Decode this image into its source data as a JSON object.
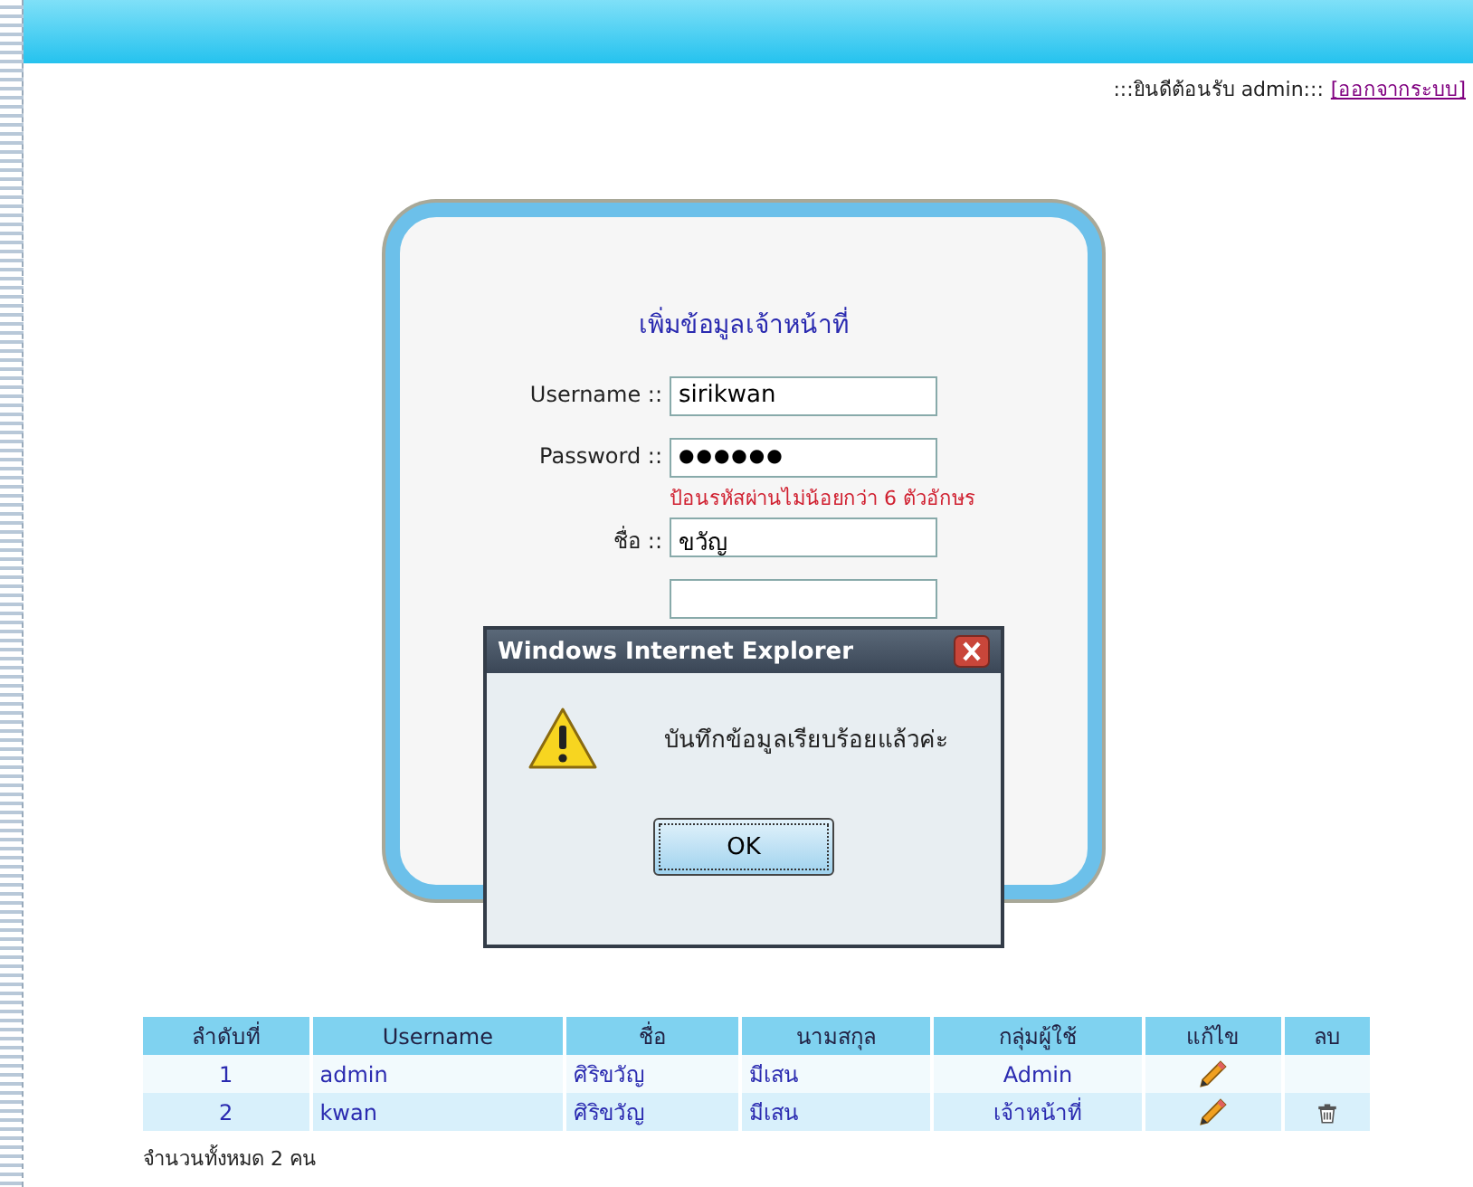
{
  "header": {
    "welcome": ":::ยินดีต้อนรับ admin:::",
    "logout_link": "[ออกจากระบบ]"
  },
  "form": {
    "title": "เพิ่มข้อมูลเจ้าหน้าที่",
    "fields": [
      {
        "label": "Username ::",
        "kind": "text",
        "value": "sirikwan"
      },
      {
        "label": "Password ::",
        "kind": "password",
        "value": "●●●●●●",
        "hint": "ป้อนรหัสผ่านไม่น้อยกว่า 6 ตัวอักษร"
      },
      {
        "label": "ชื่อ ::",
        "kind": "text",
        "value": "ขวัญ"
      }
    ]
  },
  "dialog": {
    "title": "Windows Internet Explorer",
    "message": "บันทึกข้อมูลเรียบร้อยแล้วค่ะ",
    "button": "OK"
  },
  "table": {
    "columns": [
      "ลำดับที่",
      "Username",
      "ชื่อ",
      "นามสกุล",
      "กลุ่มผู้ใช้",
      "แก้ไข",
      "ลบ"
    ],
    "rows": [
      {
        "cells": [
          "1",
          "admin",
          "ศิริขวัญ",
          "มีเสน",
          "Admin"
        ],
        "deletable": false
      },
      {
        "cells": [
          "2",
          "kwan",
          "ศิริขวัญ",
          "มีเสน",
          "เจ้าหน้าที่"
        ],
        "deletable": true
      }
    ]
  },
  "footer": "จำนวนทั้งหมด 2 คน"
}
